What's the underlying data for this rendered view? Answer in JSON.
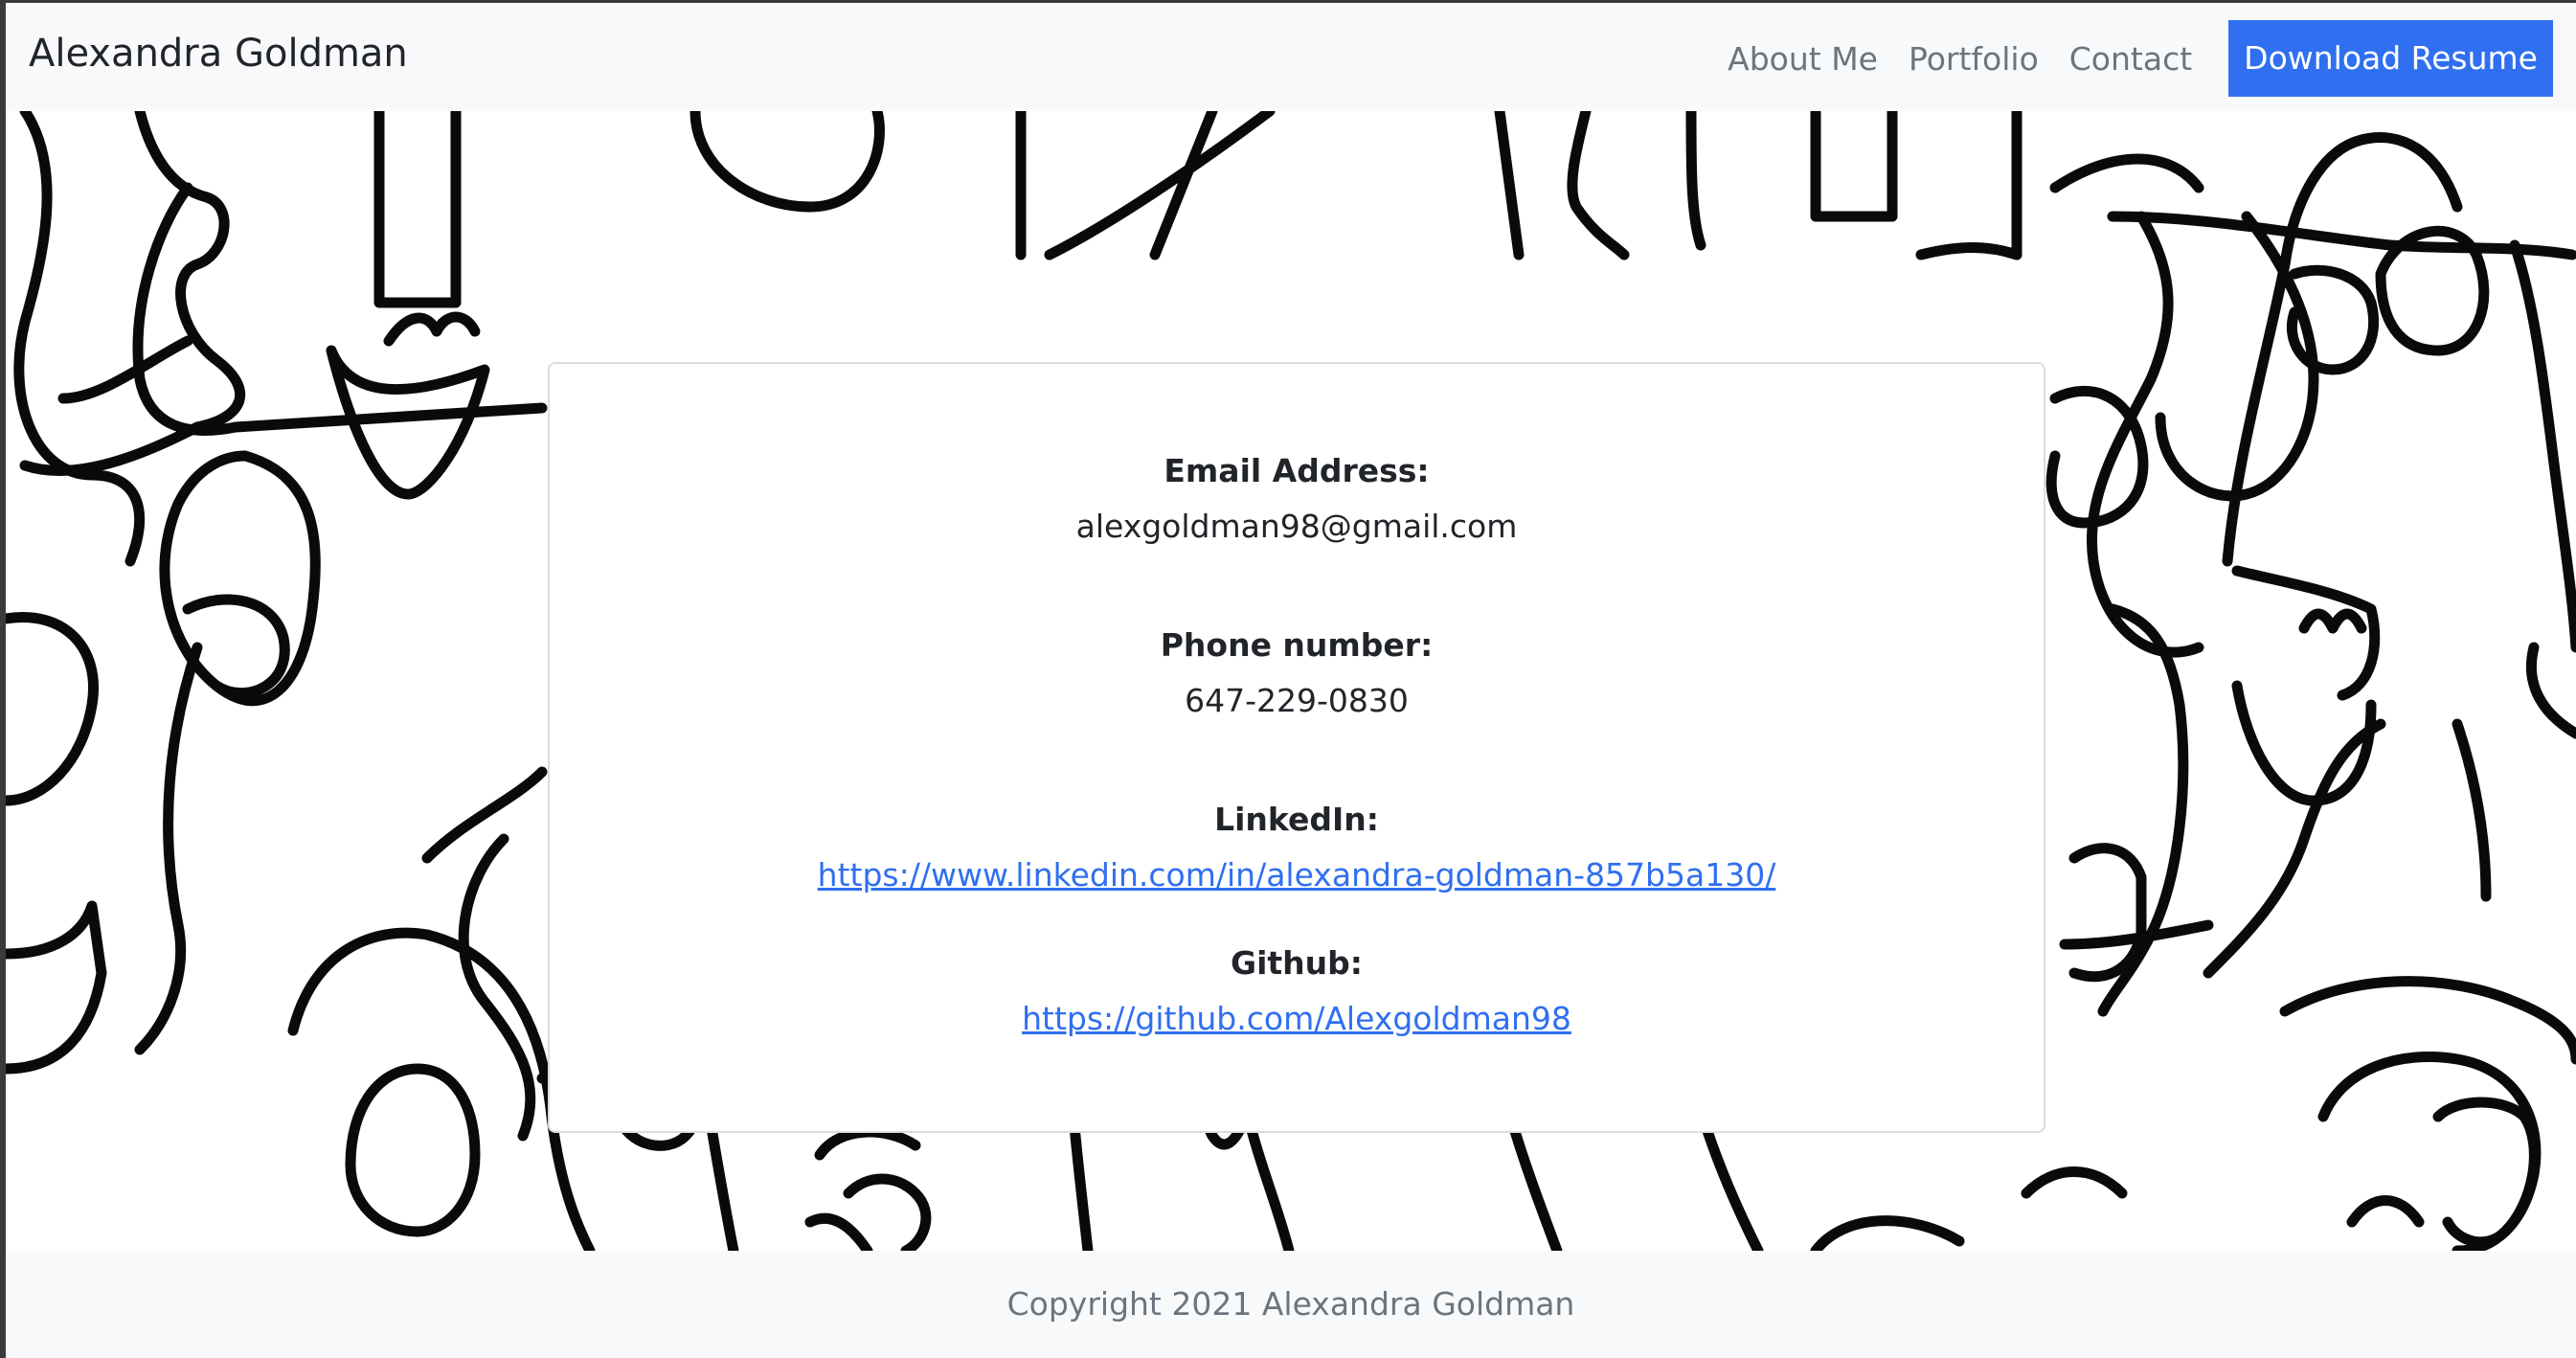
{
  "navbar": {
    "brand": "Alexandra Goldman",
    "links": [
      {
        "label": "About Me"
      },
      {
        "label": "Portfolio"
      },
      {
        "label": "Contact"
      }
    ],
    "resume_button": "Download Resume",
    "accent_color": "#2f6ff0"
  },
  "contact": {
    "email_label": "Email Address:",
    "email_value": "alexgoldman98@gmail.com",
    "phone_label": "Phone number:",
    "phone_value": "647-229-0830",
    "linkedin_label": "LinkedIn:",
    "linkedin_url": "https://www.linkedin.com/in/alexandra-goldman-857b5a130/",
    "github_label": "Github:",
    "github_url": "https://github.com/Alexgoldman98"
  },
  "footer": {
    "copyright": "Copyright 2021 Alexandra Goldman"
  },
  "hero": {
    "background_style": "line-art faces illustration"
  }
}
